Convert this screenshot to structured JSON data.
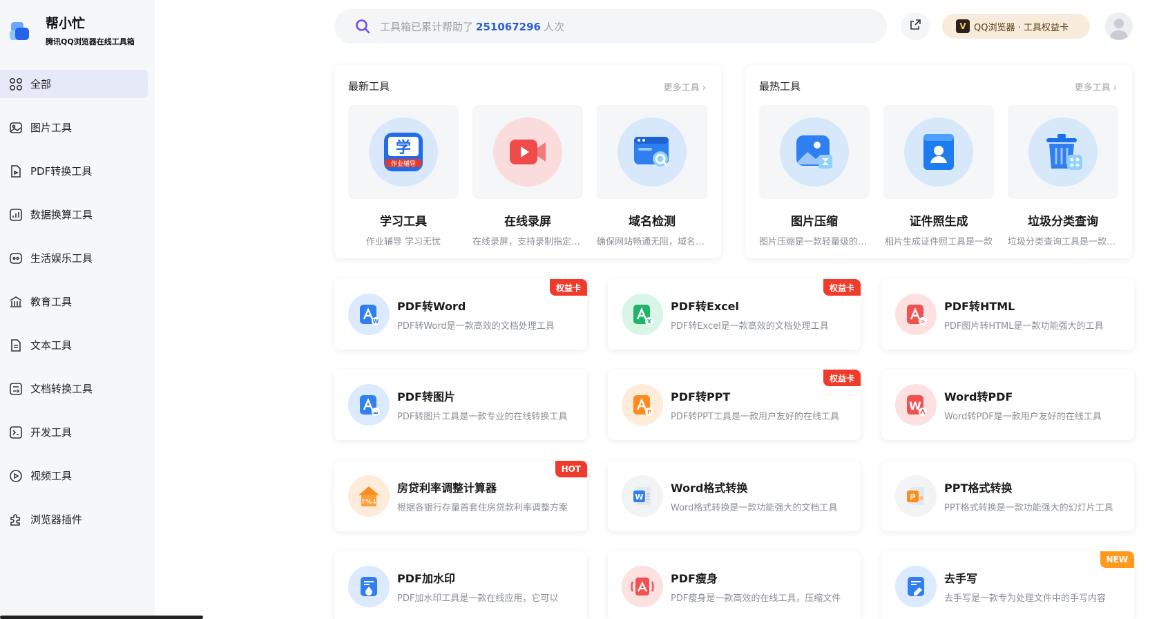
{
  "brand": {
    "title": "帮小忙",
    "subtitle": "腾讯QQ浏览器在线工具箱"
  },
  "nav": [
    {
      "label": "全部",
      "icon": "grid-icon",
      "active": true
    },
    {
      "label": "图片工具",
      "icon": "image-icon"
    },
    {
      "label": "PDF转换工具",
      "icon": "pdf-icon"
    },
    {
      "label": "数据换算工具",
      "icon": "chart-icon"
    },
    {
      "label": "生活娱乐工具",
      "icon": "entertainment-icon"
    },
    {
      "label": "教育工具",
      "icon": "education-icon"
    },
    {
      "label": "文本工具",
      "icon": "text-icon"
    },
    {
      "label": "文档转换工具",
      "icon": "document-convert-icon"
    },
    {
      "label": "开发工具",
      "icon": "terminal-icon"
    },
    {
      "label": "视频工具",
      "icon": "video-icon"
    },
    {
      "label": "浏览器插件",
      "icon": "plugin-icon"
    }
  ],
  "search": {
    "prefix": "工具箱已累计帮助了",
    "count": "251067296",
    "suffix": "人次"
  },
  "qq_badge": {
    "label": "QQ浏览器 · 工具权益卡"
  },
  "panels": {
    "latest": {
      "title": "最新工具",
      "more": "更多工具",
      "items": [
        {
          "name": "学习工具",
          "desc": "作业辅导 学习无忧",
          "icon": "homework-icon"
        },
        {
          "name": "在线录屏",
          "desc": "在线录屏，支持录制指定区域",
          "icon": "screen-record-icon"
        },
        {
          "name": "域名检测",
          "desc": "确保网站畅通无阻，域名检测",
          "icon": "domain-check-icon"
        }
      ]
    },
    "hot": {
      "title": "最热工具",
      "more": "更多工具",
      "items": [
        {
          "name": "图片压缩",
          "desc": "图片压缩是一款轻量级的工具",
          "icon": "image-compress-icon"
        },
        {
          "name": "证件照生成",
          "desc": "相片生成证件照工具是一款",
          "icon": "id-photo-icon"
        },
        {
          "name": "垃圾分类查询",
          "desc": "垃圾分类查询工具是一款实用",
          "icon": "trash-sort-icon"
        }
      ]
    }
  },
  "tools": [
    {
      "name": "PDF转Word",
      "desc": "PDF转Word是一款高效的文档处理工具",
      "tag": "权益卡",
      "icon": "pdf-to-word-icon"
    },
    {
      "name": "PDF转Excel",
      "desc": "PDF转Excel是一款高效的文档处理工具",
      "tag": "权益卡",
      "icon": "pdf-to-excel-icon"
    },
    {
      "name": "PDF转HTML",
      "desc": "PDF图片转HTML是一款功能强大的工具",
      "tag": "",
      "icon": "pdf-to-html-icon"
    },
    {
      "name": "PDF转图片",
      "desc": "PDF转图片工具是一款专业的在线转换工具",
      "tag": "",
      "icon": "pdf-to-image-icon"
    },
    {
      "name": "PDF转PPT",
      "desc": "PDF转PPT工具是一款用户友好的在线工具",
      "tag": "权益卡",
      "icon": "pdf-to-ppt-icon"
    },
    {
      "name": "Word转PDF",
      "desc": "Word转PDF是一款用户友好的在线工具",
      "tag": "",
      "icon": "word-to-pdf-icon"
    },
    {
      "name": "房贷利率调整计算器",
      "desc": "根据各银行存量首套住房贷款利率调整方案",
      "tag": "HOT",
      "icon": "mortgage-icon"
    },
    {
      "name": "Word格式转换",
      "desc": "Word格式转换是一款功能强大的文档工具",
      "tag": "",
      "icon": "word-format-icon"
    },
    {
      "name": "PPT格式转换",
      "desc": "PPT格式转换是一款功能强大的幻灯片工具",
      "tag": "",
      "icon": "ppt-format-icon"
    },
    {
      "name": "PDF加水印",
      "desc": "PDF加水印工具是一款在线应用，它可以",
      "tag": "",
      "icon": "pdf-watermark-icon"
    },
    {
      "name": "PDF瘦身",
      "desc": "PDF瘦身是一款高效的在线工具，压缩文件",
      "tag": "",
      "icon": "pdf-compress-icon"
    },
    {
      "name": "去手写",
      "desc": "去手写是一款专为处理文件中的手写内容",
      "tag": "NEW",
      "icon": "remove-handwriting-icon"
    }
  ]
}
